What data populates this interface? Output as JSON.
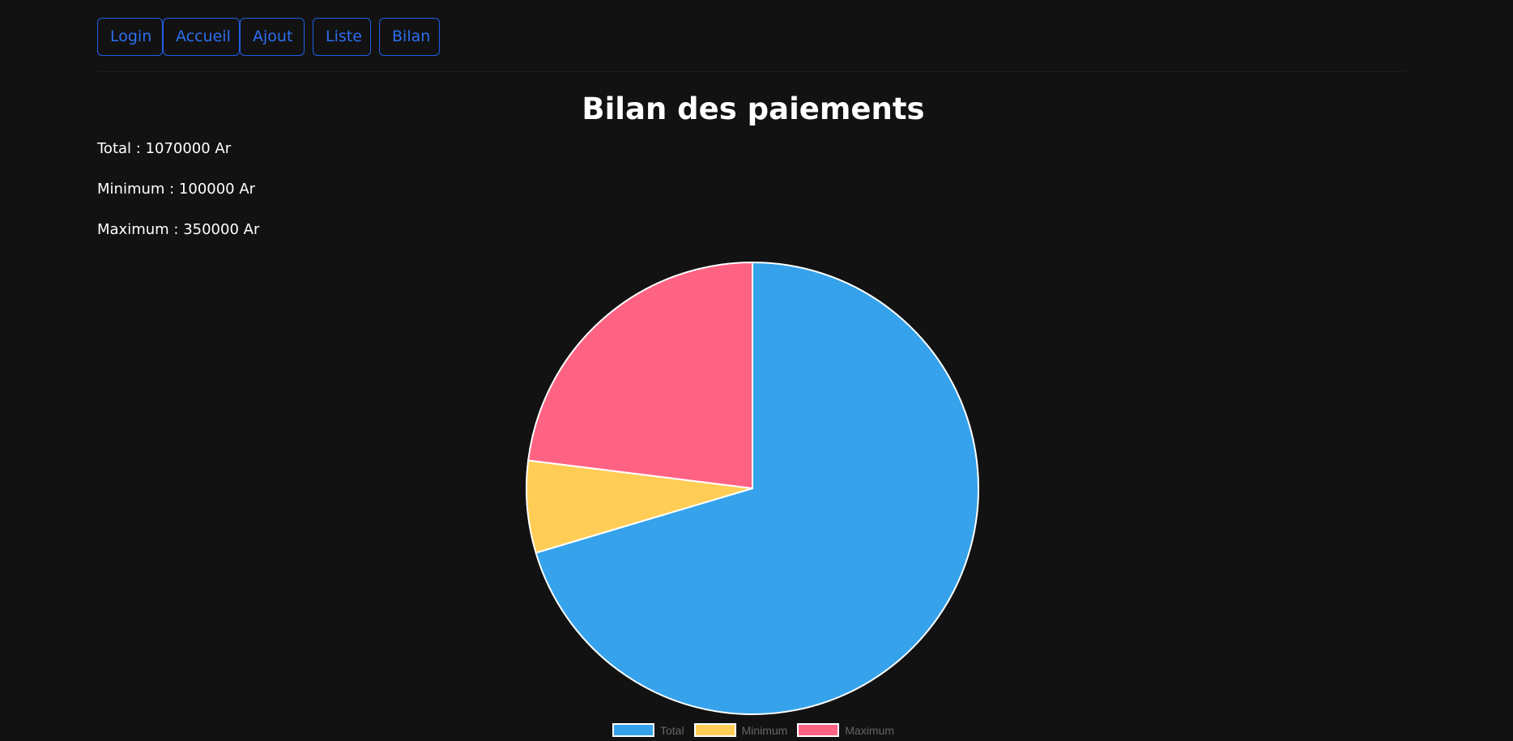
{
  "nav": {
    "items": [
      {
        "label": "Login"
      },
      {
        "label": "Accueil"
      },
      {
        "label": "Ajout"
      },
      {
        "label": "Liste"
      },
      {
        "label": "Bilan"
      }
    ]
  },
  "page": {
    "title": "Bilan des paiements"
  },
  "stats": {
    "total": "Total : 1070000 Ar",
    "minimum": "Minimum : 100000 Ar",
    "maximum": "Maximum : 350000 Ar"
  },
  "colors": {
    "background": "#121212",
    "nav_border": "#1f5fe8",
    "nav_text": "#2d6ef0"
  },
  "chart_data": {
    "type": "pie",
    "categories": [
      "Total",
      "Minimum",
      "Maximum"
    ],
    "values": [
      1070000,
      100000,
      350000
    ],
    "colors": [
      "#36a2eb",
      "#ffcd56",
      "#ff6384"
    ],
    "legend_position": "bottom"
  }
}
